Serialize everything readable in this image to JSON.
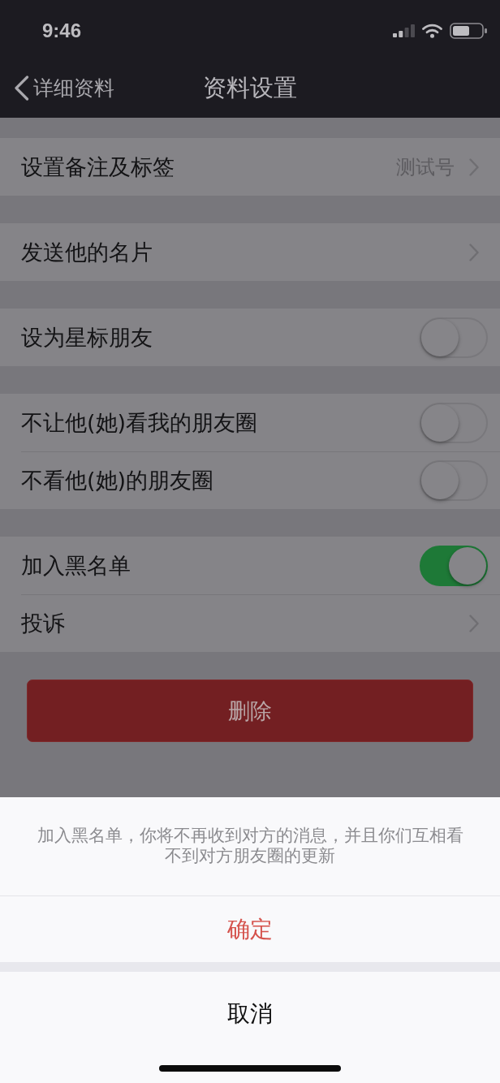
{
  "status_bar": {
    "time": "9:46"
  },
  "nav_bar": {
    "back_label": "详细资料",
    "title": "资料设置"
  },
  "groups": [
    {
      "rows": [
        {
          "kind": "link",
          "label": "设置备注及标签",
          "value": "测试号"
        }
      ]
    },
    {
      "rows": [
        {
          "kind": "link",
          "label": "发送他的名片"
        }
      ]
    },
    {
      "rows": [
        {
          "kind": "toggle",
          "label": "设为星标朋友",
          "on": false
        }
      ]
    },
    {
      "rows": [
        {
          "kind": "toggle",
          "label": "不让他(她)看我的朋友圈",
          "on": false
        },
        {
          "kind": "toggle",
          "label": "不看他(她)的朋友圈",
          "on": false
        }
      ]
    },
    {
      "rows": [
        {
          "kind": "toggle",
          "label": "加入黑名单",
          "on": true
        },
        {
          "kind": "link",
          "label": "投诉"
        }
      ]
    }
  ],
  "delete_button": {
    "label": "删除"
  },
  "action_sheet": {
    "message": "加入黑名单，你将不再收到对方的消息，并且你们互相看不到对方朋友圈的更新",
    "confirm": "确定",
    "cancel": "取消"
  }
}
